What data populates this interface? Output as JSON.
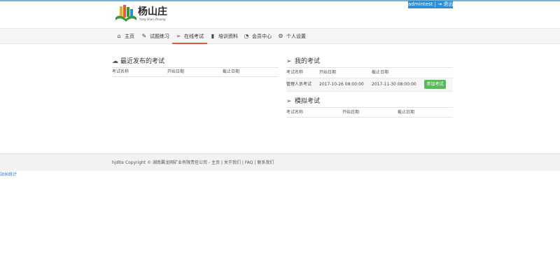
{
  "userbar": {
    "username": "admintest",
    "separator": "|",
    "logout_icon": "logout-icon",
    "logout_label": "退出"
  },
  "logo": {
    "brand": "杨山庄",
    "sub": "Yang Shan Zhuang"
  },
  "nav": [
    {
      "label": "主页",
      "icon": "home-icon"
    },
    {
      "label": "试题练习",
      "icon": "edit-icon"
    },
    {
      "label": "在线考试",
      "icon": "send-icon",
      "active": true
    },
    {
      "label": "培训资料",
      "icon": "book-icon"
    },
    {
      "label": "会员中心",
      "icon": "dashboard-icon"
    },
    {
      "label": "个人设置",
      "icon": "cogs-icon"
    }
  ],
  "recent": {
    "title": "最近发布的考试",
    "columns": [
      "考试名称",
      "开始日期",
      "截止日期"
    ]
  },
  "my_exams": {
    "title": "我的考试",
    "columns": [
      "考试名称",
      "开始日期",
      "截止日期"
    ],
    "rows": [
      {
        "name": "管理人员考试",
        "start": "2017-10-26 08:00:00",
        "end": "2017-11-30 08:00:00",
        "action": "参加考试"
      }
    ]
  },
  "mock": {
    "title": "模拟考试",
    "columns": [
      "考试名称",
      "开始日期",
      "截止日期"
    ]
  },
  "footer": {
    "copyright": "hjdlte Copyright © 湖南翼龙网矿业有限责任公司 -",
    "links": [
      "主页",
      "关于我们",
      "FAQ",
      "联系我们"
    ],
    "separator": "|"
  },
  "stats_link": "站长统计",
  "colors": {
    "accent": "#2a8fd8",
    "active_underline": "#e05a4a",
    "button_green": "#5cb85c"
  }
}
